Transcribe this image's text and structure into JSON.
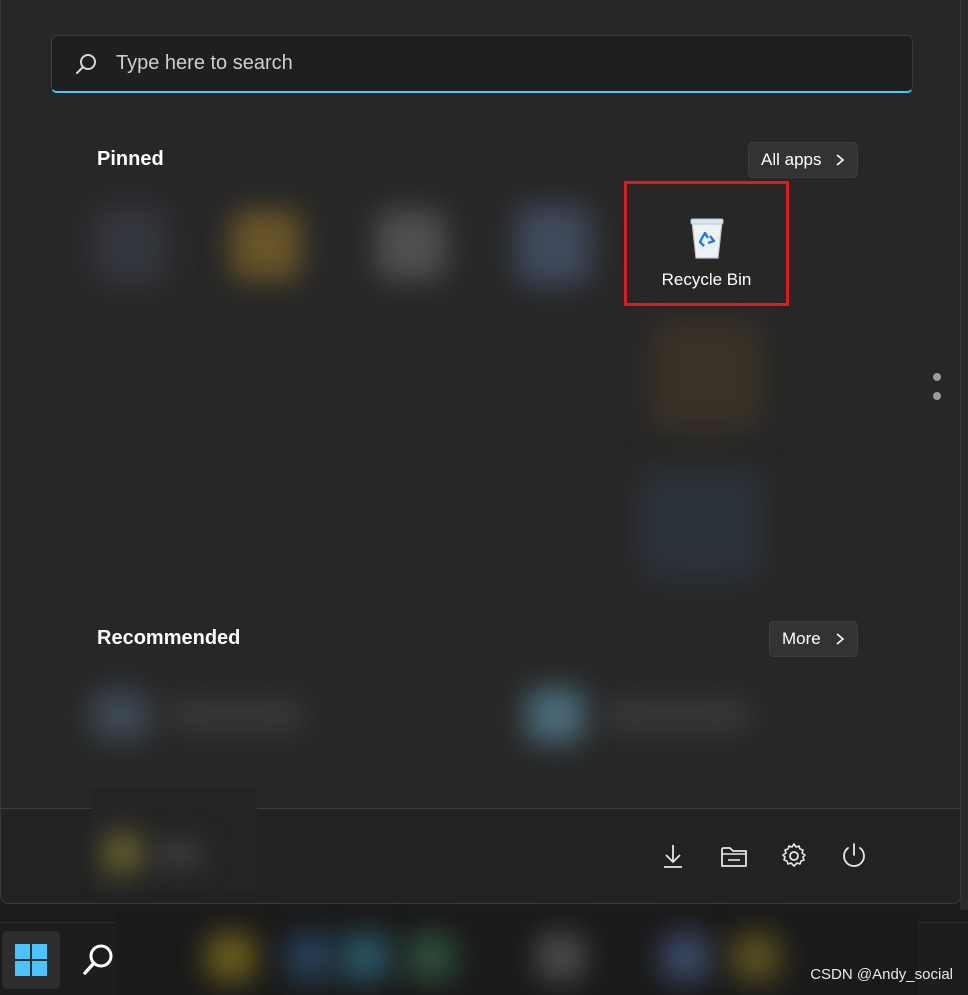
{
  "search": {
    "placeholder": "Type here to search",
    "icon": "search-icon"
  },
  "pinned": {
    "title": "Pinned",
    "all_apps_label": "All apps",
    "apps": [
      {
        "label": "Recycle Bin",
        "icon": "recycle-bin-icon"
      }
    ]
  },
  "recommended": {
    "title": "Recommended",
    "more_label": "More"
  },
  "footer": {
    "icons": [
      "downloads-icon",
      "file-explorer-icon",
      "settings-icon",
      "power-icon"
    ]
  },
  "taskbar": {
    "start_icon": "windows-logo-icon",
    "search_icon": "search-icon"
  },
  "watermark": "CSDN @Andy_social",
  "colors": {
    "accent": "#4cc2ff",
    "highlight_border": "#e11a22",
    "menu_bg": "#272727"
  }
}
